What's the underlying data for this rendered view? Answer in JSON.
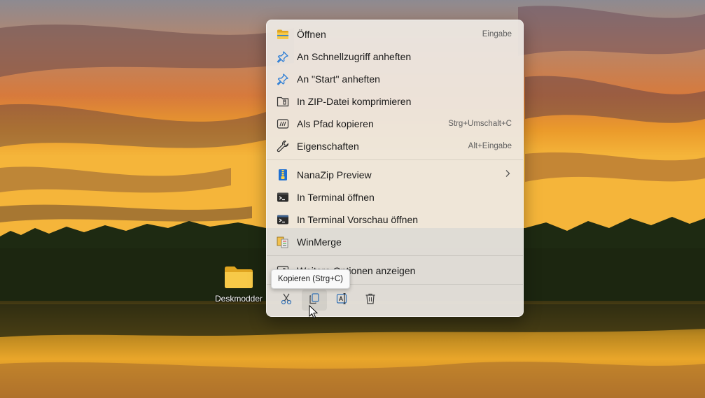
{
  "desktop": {
    "icon_label": "Deskmodder"
  },
  "context_menu": {
    "items": [
      {
        "label": "Öffnen",
        "shortcut": "Eingabe",
        "icon": "folder-icon"
      },
      {
        "label": "An Schnellzugriff anheften",
        "shortcut": "",
        "icon": "pin-icon"
      },
      {
        "label": "An \"Start\" anheften",
        "shortcut": "",
        "icon": "pin-icon"
      },
      {
        "label": "In ZIP-Datei komprimieren",
        "shortcut": "",
        "icon": "zip-icon"
      },
      {
        "label": "Als Pfad kopieren",
        "shortcut": "Strg+Umschalt+C",
        "icon": "copy-path-icon"
      },
      {
        "label": "Eigenschaften",
        "shortcut": "Alt+Eingabe",
        "icon": "wrench-icon"
      },
      {
        "label": "NanaZip Preview",
        "shortcut": "",
        "icon": "nanazip-icon",
        "submenu": true
      },
      {
        "label": "In  Terminal öffnen",
        "shortcut": "",
        "icon": "terminal-icon"
      },
      {
        "label": "In Terminal  Vorschau öffnen",
        "shortcut": "",
        "icon": "terminal-preview-icon"
      },
      {
        "label": "WinMerge",
        "shortcut": "",
        "icon": "winmerge-icon"
      },
      {
        "label": "Weitere Optionen anzeigen",
        "shortcut": "",
        "icon": "more-options-icon"
      }
    ],
    "toolbar": [
      "cut-icon",
      "copy-icon",
      "rename-icon",
      "delete-icon"
    ]
  },
  "tooltip": {
    "text": "Kopieren (Strg+C)"
  },
  "colors": {
    "accent": "#0067c0",
    "menu_bg": "#eee9e4",
    "folder": "#f5c242"
  }
}
